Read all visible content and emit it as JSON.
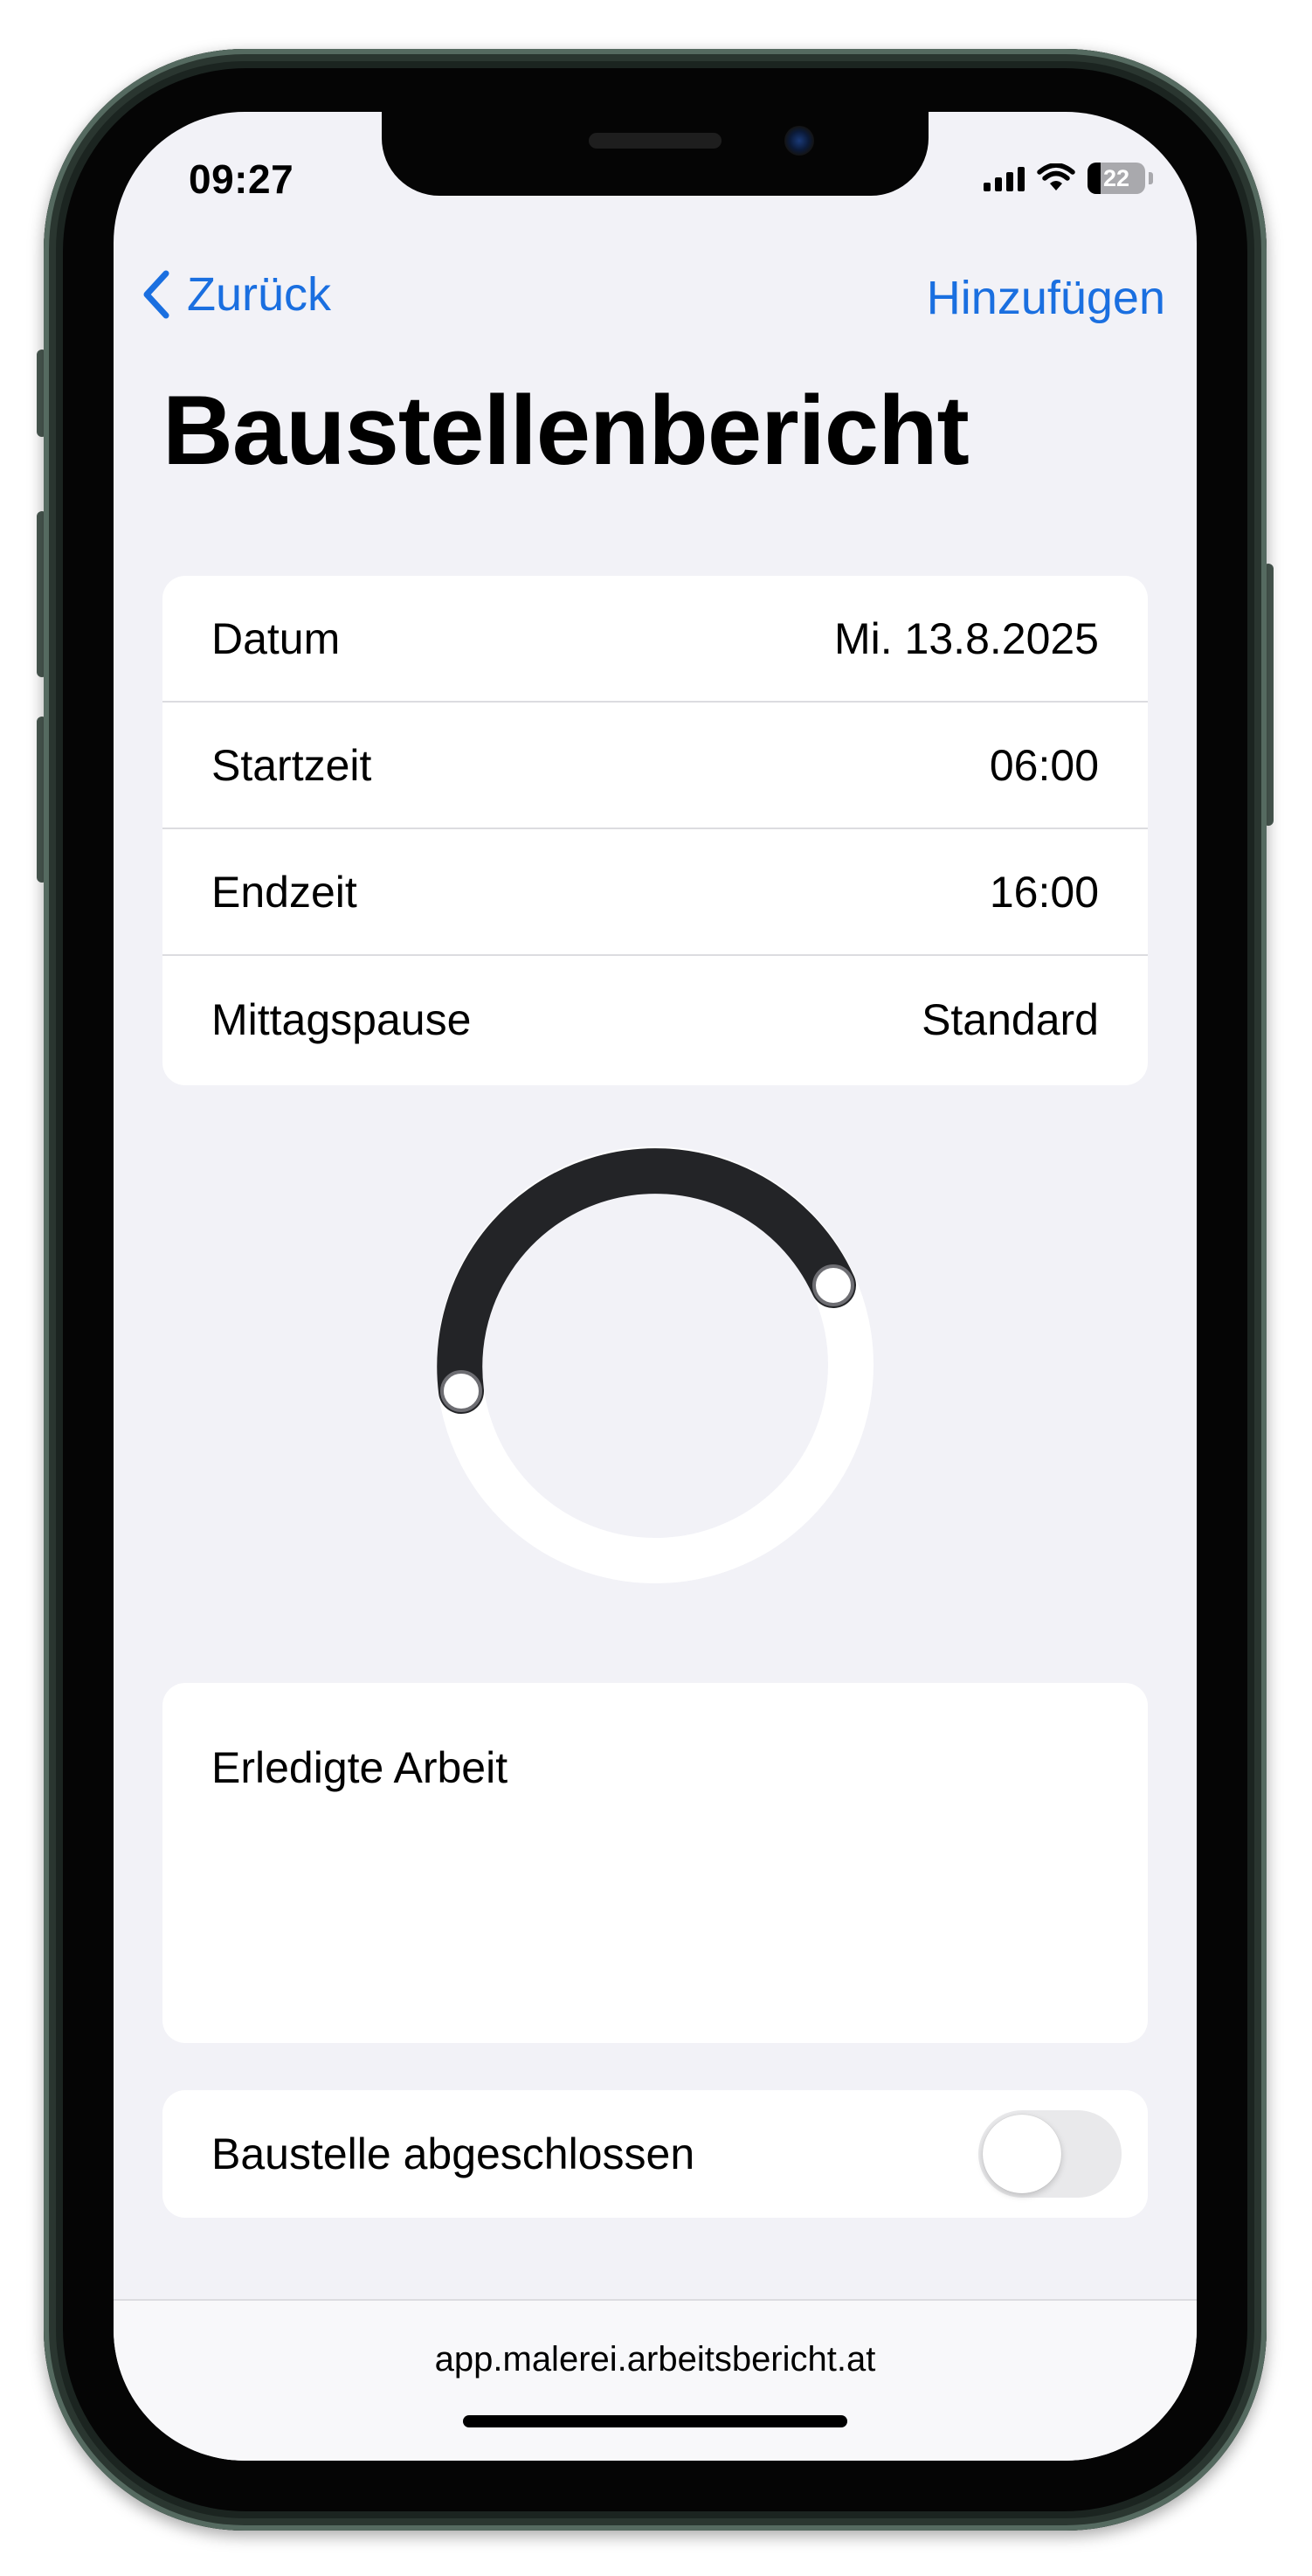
{
  "status_bar": {
    "time": "09:27",
    "signal_icon": "cellular-signal-icon",
    "wifi_icon": "wifi-icon",
    "battery_level": "22"
  },
  "nav": {
    "back_label": "Zurück",
    "back_icon": "chevron-left-icon",
    "add_label": "Hinzufügen",
    "accent_color": "#1a6fe0"
  },
  "page": {
    "title": "Baustellenbericht"
  },
  "form": {
    "rows": [
      {
        "label": "Datum",
        "value": "Mi. 13.8.2025"
      },
      {
        "label": "Startzeit",
        "value": "06:00"
      },
      {
        "label": "Endzeit",
        "value": "16:00"
      },
      {
        "label": "Mittagspause",
        "value": "Standard"
      }
    ]
  },
  "time_dial": {
    "start": "06:00",
    "end": "16:00",
    "arc_color": "#232427",
    "track_color": "#ffffff"
  },
  "work": {
    "label": "Erledigte Arbeit",
    "value": ""
  },
  "completed": {
    "label": "Baustelle abgeschlossen",
    "checked": false
  },
  "browser": {
    "address": "app.malerei.arbeitsbericht.at"
  }
}
